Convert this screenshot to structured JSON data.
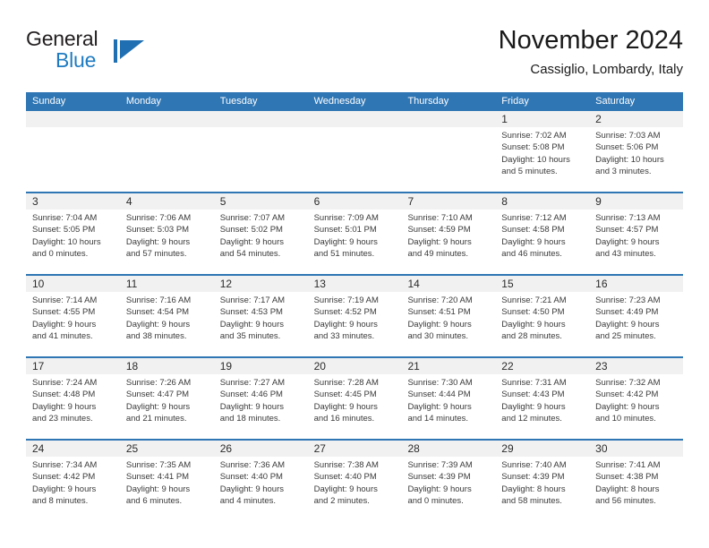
{
  "brand": {
    "name_part1": "General",
    "name_part2": "Blue",
    "mark_icon": "triangle-flag-icon",
    "accent_color": "#1f7bc1"
  },
  "header": {
    "title": "November 2024",
    "subtitle": "Cassiglio, Lombardy, Italy"
  },
  "calendar": {
    "header_bg": "#2f76b4",
    "date_band_bg": "#f1f1f1",
    "weekdays": [
      "Sunday",
      "Monday",
      "Tuesday",
      "Wednesday",
      "Thursday",
      "Friday",
      "Saturday"
    ],
    "weeks": [
      [
        {
          "date": "",
          "lines": []
        },
        {
          "date": "",
          "lines": []
        },
        {
          "date": "",
          "lines": []
        },
        {
          "date": "",
          "lines": []
        },
        {
          "date": "",
          "lines": []
        },
        {
          "date": "1",
          "lines": [
            "Sunrise: 7:02 AM",
            "Sunset: 5:08 PM",
            "Daylight: 10 hours",
            "and 5 minutes."
          ]
        },
        {
          "date": "2",
          "lines": [
            "Sunrise: 7:03 AM",
            "Sunset: 5:06 PM",
            "Daylight: 10 hours",
            "and 3 minutes."
          ]
        }
      ],
      [
        {
          "date": "3",
          "lines": [
            "Sunrise: 7:04 AM",
            "Sunset: 5:05 PM",
            "Daylight: 10 hours",
            "and 0 minutes."
          ]
        },
        {
          "date": "4",
          "lines": [
            "Sunrise: 7:06 AM",
            "Sunset: 5:03 PM",
            "Daylight: 9 hours",
            "and 57 minutes."
          ]
        },
        {
          "date": "5",
          "lines": [
            "Sunrise: 7:07 AM",
            "Sunset: 5:02 PM",
            "Daylight: 9 hours",
            "and 54 minutes."
          ]
        },
        {
          "date": "6",
          "lines": [
            "Sunrise: 7:09 AM",
            "Sunset: 5:01 PM",
            "Daylight: 9 hours",
            "and 51 minutes."
          ]
        },
        {
          "date": "7",
          "lines": [
            "Sunrise: 7:10 AM",
            "Sunset: 4:59 PM",
            "Daylight: 9 hours",
            "and 49 minutes."
          ]
        },
        {
          "date": "8",
          "lines": [
            "Sunrise: 7:12 AM",
            "Sunset: 4:58 PM",
            "Daylight: 9 hours",
            "and 46 minutes."
          ]
        },
        {
          "date": "9",
          "lines": [
            "Sunrise: 7:13 AM",
            "Sunset: 4:57 PM",
            "Daylight: 9 hours",
            "and 43 minutes."
          ]
        }
      ],
      [
        {
          "date": "10",
          "lines": [
            "Sunrise: 7:14 AM",
            "Sunset: 4:55 PM",
            "Daylight: 9 hours",
            "and 41 minutes."
          ]
        },
        {
          "date": "11",
          "lines": [
            "Sunrise: 7:16 AM",
            "Sunset: 4:54 PM",
            "Daylight: 9 hours",
            "and 38 minutes."
          ]
        },
        {
          "date": "12",
          "lines": [
            "Sunrise: 7:17 AM",
            "Sunset: 4:53 PM",
            "Daylight: 9 hours",
            "and 35 minutes."
          ]
        },
        {
          "date": "13",
          "lines": [
            "Sunrise: 7:19 AM",
            "Sunset: 4:52 PM",
            "Daylight: 9 hours",
            "and 33 minutes."
          ]
        },
        {
          "date": "14",
          "lines": [
            "Sunrise: 7:20 AM",
            "Sunset: 4:51 PM",
            "Daylight: 9 hours",
            "and 30 minutes."
          ]
        },
        {
          "date": "15",
          "lines": [
            "Sunrise: 7:21 AM",
            "Sunset: 4:50 PM",
            "Daylight: 9 hours",
            "and 28 minutes."
          ]
        },
        {
          "date": "16",
          "lines": [
            "Sunrise: 7:23 AM",
            "Sunset: 4:49 PM",
            "Daylight: 9 hours",
            "and 25 minutes."
          ]
        }
      ],
      [
        {
          "date": "17",
          "lines": [
            "Sunrise: 7:24 AM",
            "Sunset: 4:48 PM",
            "Daylight: 9 hours",
            "and 23 minutes."
          ]
        },
        {
          "date": "18",
          "lines": [
            "Sunrise: 7:26 AM",
            "Sunset: 4:47 PM",
            "Daylight: 9 hours",
            "and 21 minutes."
          ]
        },
        {
          "date": "19",
          "lines": [
            "Sunrise: 7:27 AM",
            "Sunset: 4:46 PM",
            "Daylight: 9 hours",
            "and 18 minutes."
          ]
        },
        {
          "date": "20",
          "lines": [
            "Sunrise: 7:28 AM",
            "Sunset: 4:45 PM",
            "Daylight: 9 hours",
            "and 16 minutes."
          ]
        },
        {
          "date": "21",
          "lines": [
            "Sunrise: 7:30 AM",
            "Sunset: 4:44 PM",
            "Daylight: 9 hours",
            "and 14 minutes."
          ]
        },
        {
          "date": "22",
          "lines": [
            "Sunrise: 7:31 AM",
            "Sunset: 4:43 PM",
            "Daylight: 9 hours",
            "and 12 minutes."
          ]
        },
        {
          "date": "23",
          "lines": [
            "Sunrise: 7:32 AM",
            "Sunset: 4:42 PM",
            "Daylight: 9 hours",
            "and 10 minutes."
          ]
        }
      ],
      [
        {
          "date": "24",
          "lines": [
            "Sunrise: 7:34 AM",
            "Sunset: 4:42 PM",
            "Daylight: 9 hours",
            "and 8 minutes."
          ]
        },
        {
          "date": "25",
          "lines": [
            "Sunrise: 7:35 AM",
            "Sunset: 4:41 PM",
            "Daylight: 9 hours",
            "and 6 minutes."
          ]
        },
        {
          "date": "26",
          "lines": [
            "Sunrise: 7:36 AM",
            "Sunset: 4:40 PM",
            "Daylight: 9 hours",
            "and 4 minutes."
          ]
        },
        {
          "date": "27",
          "lines": [
            "Sunrise: 7:38 AM",
            "Sunset: 4:40 PM",
            "Daylight: 9 hours",
            "and 2 minutes."
          ]
        },
        {
          "date": "28",
          "lines": [
            "Sunrise: 7:39 AM",
            "Sunset: 4:39 PM",
            "Daylight: 9 hours",
            "and 0 minutes."
          ]
        },
        {
          "date": "29",
          "lines": [
            "Sunrise: 7:40 AM",
            "Sunset: 4:39 PM",
            "Daylight: 8 hours",
            "and 58 minutes."
          ]
        },
        {
          "date": "30",
          "lines": [
            "Sunrise: 7:41 AM",
            "Sunset: 4:38 PM",
            "Daylight: 8 hours",
            "and 56 minutes."
          ]
        }
      ]
    ]
  }
}
